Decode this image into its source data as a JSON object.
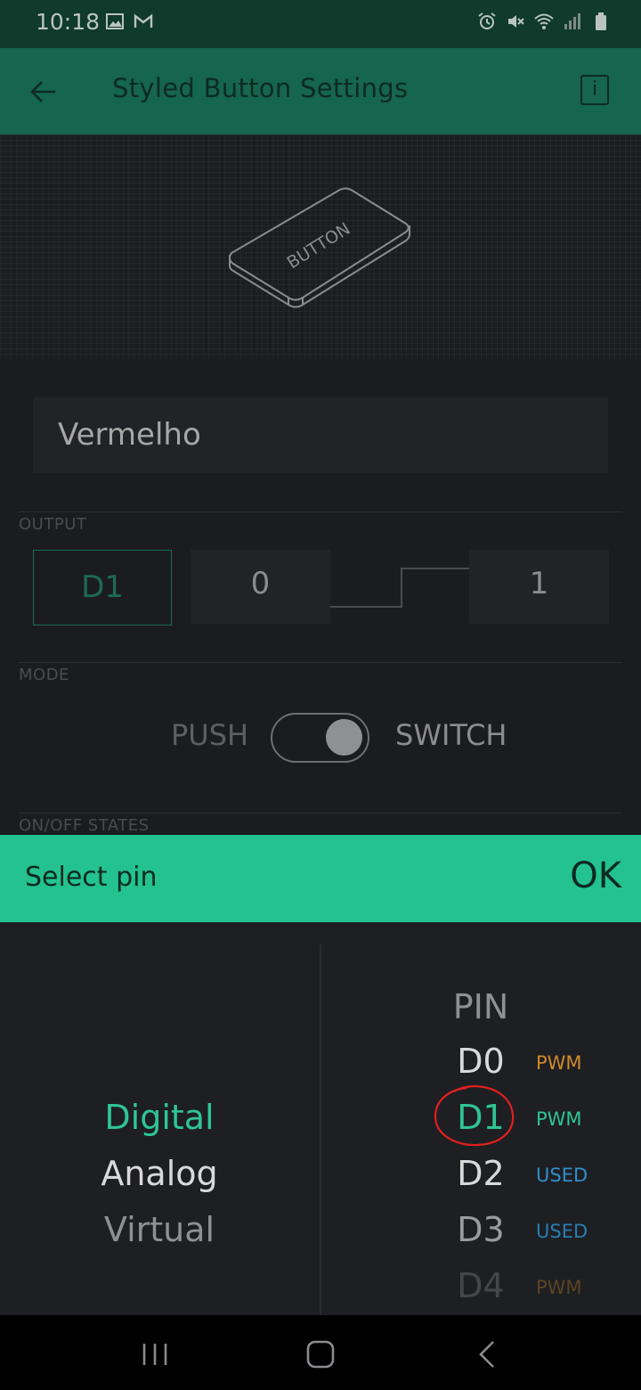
{
  "status_bar": {
    "time": "10:18",
    "left_icons": [
      "image-icon",
      "gmail-icon"
    ],
    "right_icons": [
      "alarm-icon",
      "mute-icon",
      "wifi-icon",
      "signal-icon",
      "battery-icon"
    ]
  },
  "app_bar": {
    "title": "Styled Button Settings",
    "info_label": "i"
  },
  "preview": {
    "button_text": "BUTTON"
  },
  "form": {
    "name_value": "Vermelho",
    "output_label": "OUTPUT",
    "pin_value": "D1",
    "off_value": "0",
    "on_value": "1",
    "mode_label": "MODE",
    "mode_push": "PUSH",
    "mode_switch": "SWITCH",
    "mode_selected": "SWITCH",
    "states_label": "ON/OFF STATES"
  },
  "sheet": {
    "title": "Select pin",
    "ok_label": "OK",
    "pin_types": [
      {
        "label": "Digital",
        "selected": true
      },
      {
        "label": "Analog",
        "selected": false
      },
      {
        "label": "Virtual",
        "selected": false
      }
    ],
    "pin_column_header": "PIN",
    "pins": [
      {
        "name": "D0",
        "tag": "PWM"
      },
      {
        "name": "D1",
        "tag": "PWM",
        "selected": true
      },
      {
        "name": "D2",
        "tag": "USED"
      },
      {
        "name": "D3",
        "tag": "USED"
      },
      {
        "name": "D4",
        "tag": "PWM"
      }
    ]
  },
  "colors": {
    "accent": "#23c28e",
    "app_bar": "#16654d",
    "pwm_tag": "#d08a2a",
    "used_tag": "#2f8fc9",
    "annotation": "#e0201f"
  }
}
